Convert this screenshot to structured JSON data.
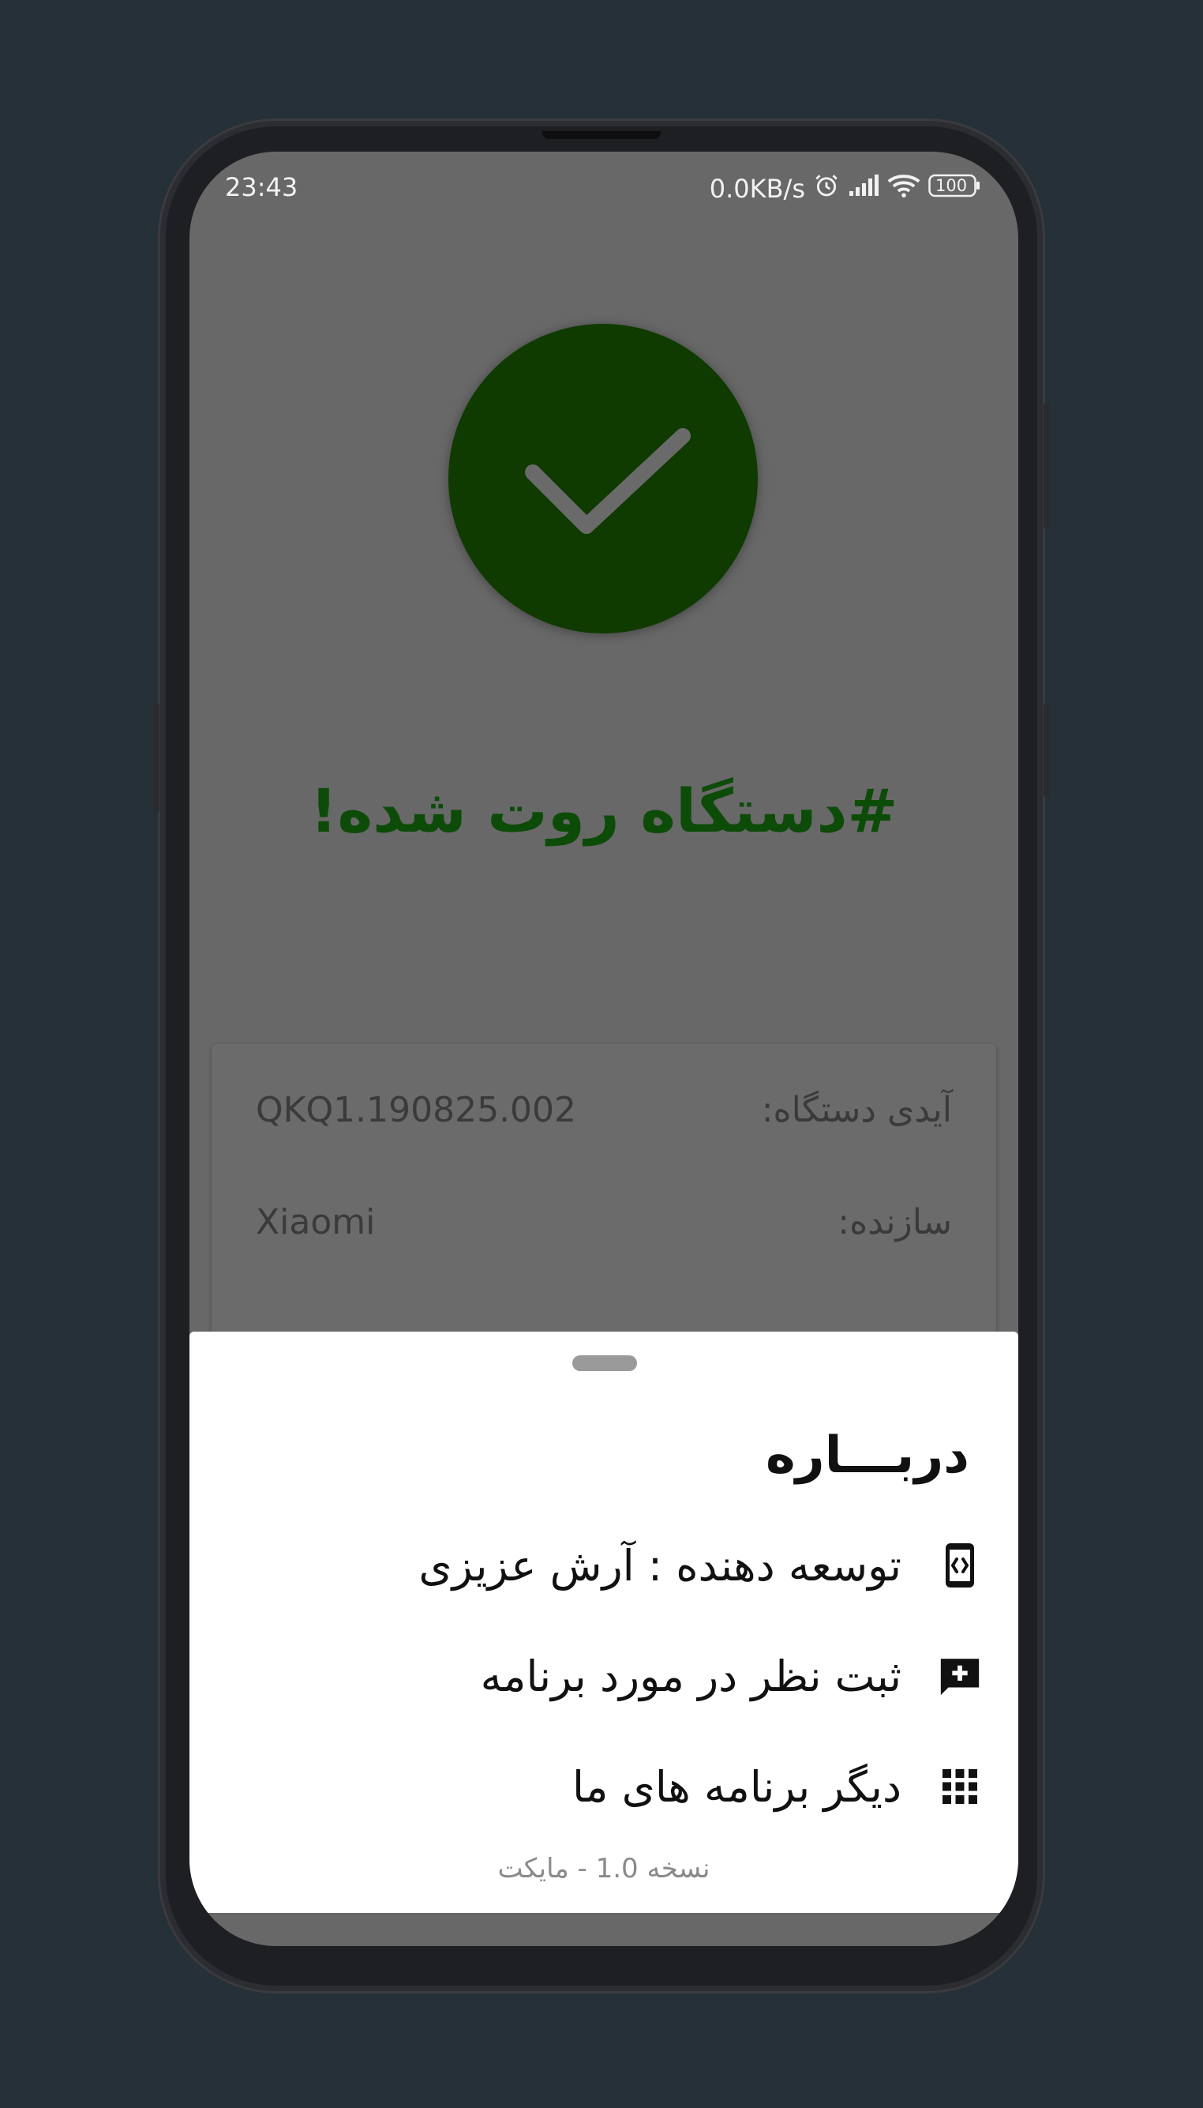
{
  "status_bar": {
    "time": "23:43",
    "network_speed": "0.0KB/s",
    "battery": "100",
    "icons": [
      "alarm-icon",
      "signal-icon",
      "wifi-icon",
      "battery-icon"
    ]
  },
  "root_status": {
    "icon": "checkmark-icon",
    "title": "#دستگاه روت شده!",
    "colors": {
      "circle": "#0f3a00",
      "title": "#0d4b08"
    }
  },
  "device_info": {
    "rows": [
      {
        "label": "آیدی دستگاه:",
        "value": "QKQ1.190825.002"
      },
      {
        "label": "سازنده:",
        "value": "Xiaomi"
      }
    ]
  },
  "about_sheet": {
    "title": "دربـــاره",
    "items": [
      {
        "label": "توسعه دهنده : آرش عزیزی",
        "icon": "developer-mode-icon"
      },
      {
        "label": "ثبت نظر در مورد برنامه",
        "icon": "add-comment-icon"
      },
      {
        "label": "دیگر برنامه های ما",
        "icon": "apps-grid-icon"
      }
    ],
    "version": "نسخه 1.0 - مایکت"
  }
}
